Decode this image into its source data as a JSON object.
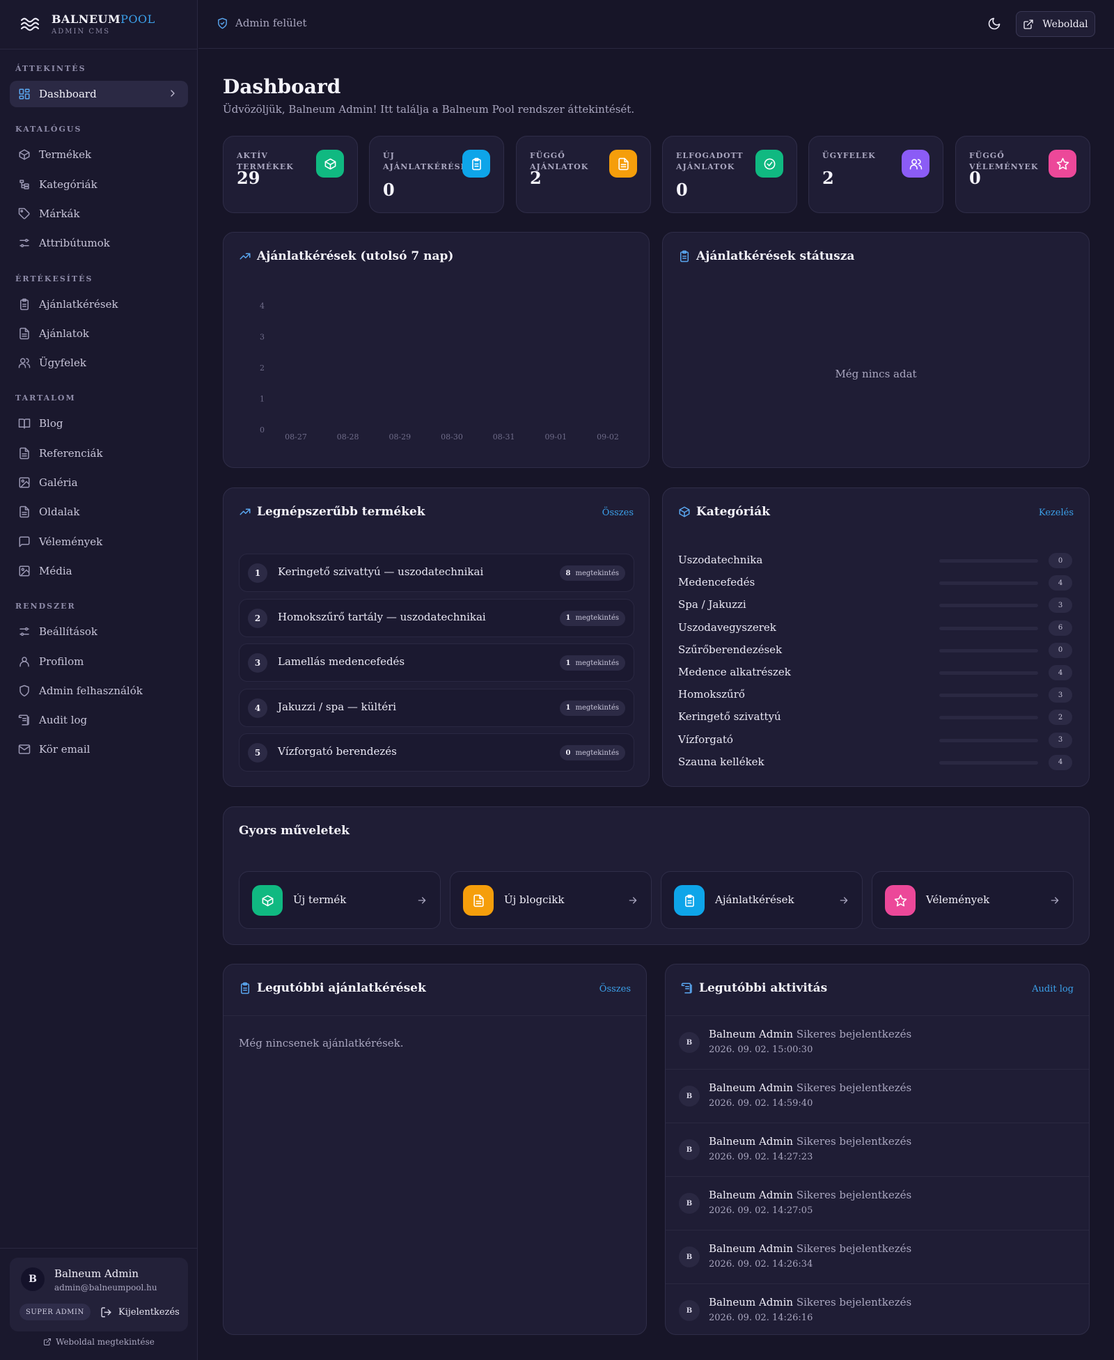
{
  "brand": {
    "name_main": "BALNEUM",
    "name_accent": "POOL",
    "subtitle": "ADMIN CMS"
  },
  "sidebar": {
    "sections": [
      {
        "title": "ÁTTEKINTÉS",
        "items": [
          {
            "label": "Dashboard",
            "icon": "dashboard-grid-icon",
            "active": true
          }
        ]
      },
      {
        "title": "KATALÓGUS",
        "items": [
          {
            "label": "Termékek",
            "icon": "box-icon"
          },
          {
            "label": "Kategóriák",
            "icon": "hierarchy-icon"
          },
          {
            "label": "Márkák",
            "icon": "tag-icon"
          },
          {
            "label": "Attribútumok",
            "icon": "sliders-icon"
          }
        ]
      },
      {
        "title": "ÉRTÉKESÍTÉS",
        "items": [
          {
            "label": "Ajánlatkérések",
            "icon": "clipboard-icon"
          },
          {
            "label": "Ajánlatok",
            "icon": "document-icon"
          },
          {
            "label": "Ügyfelek",
            "icon": "users-icon"
          }
        ]
      },
      {
        "title": "TARTALOM",
        "items": [
          {
            "label": "Blog",
            "icon": "book-icon"
          },
          {
            "label": "Referenciák",
            "icon": "document-icon"
          },
          {
            "label": "Galéria",
            "icon": "image-icon"
          },
          {
            "label": "Oldalak",
            "icon": "document-icon"
          },
          {
            "label": "Vélemények",
            "icon": "chat-icon"
          },
          {
            "label": "Média",
            "icon": "image-icon"
          }
        ]
      },
      {
        "title": "RENDSZER",
        "items": [
          {
            "label": "Beállítások",
            "icon": "sliders-icon"
          },
          {
            "label": "Profilom",
            "icon": "user-icon"
          },
          {
            "label": "Admin felhasználók",
            "icon": "shield-icon"
          },
          {
            "label": "Audit log",
            "icon": "scroll-icon"
          },
          {
            "label": "Kör email",
            "icon": "mail-icon"
          }
        ]
      }
    ],
    "user": {
      "initial": "B",
      "name": "Balneum Admin",
      "email": "admin@balneumpool.hu",
      "role": "SUPER ADMIN",
      "logout_label": "Kijelentkezés"
    },
    "view_site_label": "Weboldal megtekintése"
  },
  "topbar": {
    "admin_label": "Admin felület",
    "site_button": "Weboldal"
  },
  "page": {
    "title": "Dashboard",
    "subtitle": "Üdvözöljük, Balneum Admin! Itt találja a Balneum Pool rendszer áttekintését."
  },
  "stats": [
    {
      "label": "AKTÍV TERMÉKEK",
      "value": "29",
      "icon": "box-icon",
      "color": "#10b981"
    },
    {
      "label": "ÚJ AJÁNLATKÉRÉSEK",
      "value": "0",
      "icon": "clipboard-icon",
      "color": "#0ea5e9"
    },
    {
      "label": "FÜGGŐ AJÁNLATOK",
      "value": "2",
      "icon": "document-icon",
      "color": "#f59e0b"
    },
    {
      "label": "ELFOGADOTT AJÁNLATOK",
      "value": "0",
      "icon": "check-circle-icon",
      "color": "#10b981"
    },
    {
      "label": "ÜGYFELEK",
      "value": "2",
      "icon": "users-icon",
      "color": "#8b5cf6"
    },
    {
      "label": "FÜGGŐ VÉLEMÉNYEK",
      "value": "0",
      "icon": "star-icon",
      "color": "#ec4899"
    }
  ],
  "requests_chart": {
    "title": "Ajánlatkérések (utolsó 7 nap)"
  },
  "chart_data": {
    "type": "line",
    "title": "Ajánlatkérések (utolsó 7 nap)",
    "categories": [
      "08-27",
      "08-28",
      "08-29",
      "08-30",
      "08-31",
      "09-01",
      "09-02"
    ],
    "y_ticks": [
      "0",
      "1",
      "2",
      "3",
      "4"
    ],
    "series": [
      {
        "values": [
          0,
          0,
          0,
          0,
          0,
          0,
          0
        ]
      }
    ],
    "ylim": [
      0,
      4
    ],
    "grid": false,
    "legend": "none"
  },
  "status_panel": {
    "title": "Ajánlatkérések státusza",
    "empty": "Még nincs adat"
  },
  "top_products": {
    "title": "Legnépszerűbb termékek",
    "link": "Összes",
    "views_suffix": "megtekintés",
    "items": [
      {
        "rank": "1",
        "name": "Keringető szivattyú — uszodatechnikai",
        "views": "8"
      },
      {
        "rank": "2",
        "name": "Homokszűrő tartály — uszodatechnikai",
        "views": "1"
      },
      {
        "rank": "3",
        "name": "Lamellás medencefedés",
        "views": "1"
      },
      {
        "rank": "4",
        "name": "Jakuzzi / spa — kültéri",
        "views": "1"
      },
      {
        "rank": "5",
        "name": "Vízforgató berendezés",
        "views": "0"
      }
    ]
  },
  "categories": {
    "title": "Kategóriák",
    "link": "Kezelés",
    "items": [
      {
        "name": "Uszodatechnika",
        "count": "0"
      },
      {
        "name": "Medencefedés",
        "count": "4"
      },
      {
        "name": "Spa / Jakuzzi",
        "count": "3"
      },
      {
        "name": "Uszodavegyszerek",
        "count": "6"
      },
      {
        "name": "Szűrőberendezések",
        "count": "0"
      },
      {
        "name": "Medence alkatrészek",
        "count": "4"
      },
      {
        "name": "Homokszűrő",
        "count": "3"
      },
      {
        "name": "Keringető szivattyú",
        "count": "2"
      },
      {
        "name": "Vízforgató",
        "count": "3"
      },
      {
        "name": "Szauna kellékek",
        "count": "4"
      }
    ]
  },
  "quick_actions": {
    "title": "Gyors műveletek",
    "items": [
      {
        "label": "Új termék",
        "icon": "box-icon",
        "color": "#10b981"
      },
      {
        "label": "Új blogcikk",
        "icon": "document-icon",
        "color": "#f59e0b"
      },
      {
        "label": "Ajánlatkérések",
        "icon": "clipboard-icon",
        "color": "#0ea5e9"
      },
      {
        "label": "Vélemények",
        "icon": "star-icon",
        "color": "#ec4899"
      }
    ]
  },
  "recent_requests": {
    "title": "Legutóbbi ajánlatkérések",
    "link": "Összes",
    "empty": "Még nincsenek ajánlatkérések."
  },
  "recent_activity": {
    "title": "Legutóbbi aktivitás",
    "link": "Audit log",
    "items": [
      {
        "initial": "B",
        "user": "Balneum Admin",
        "action": "Sikeres bejelentkezés",
        "time": "2026. 09. 02. 15:00:30"
      },
      {
        "initial": "B",
        "user": "Balneum Admin",
        "action": "Sikeres bejelentkezés",
        "time": "2026. 09. 02. 14:59:40"
      },
      {
        "initial": "B",
        "user": "Balneum Admin",
        "action": "Sikeres bejelentkezés",
        "time": "2026. 09. 02. 14:27:23"
      },
      {
        "initial": "B",
        "user": "Balneum Admin",
        "action": "Sikeres bejelentkezés",
        "time": "2026. 09. 02. 14:27:05"
      },
      {
        "initial": "B",
        "user": "Balneum Admin",
        "action": "Sikeres bejelentkezés",
        "time": "2026. 09. 02. 14:26:34"
      },
      {
        "initial": "B",
        "user": "Balneum Admin",
        "action": "Sikeres bejelentkezés",
        "time": "2026. 09. 02. 14:26:16"
      }
    ]
  }
}
